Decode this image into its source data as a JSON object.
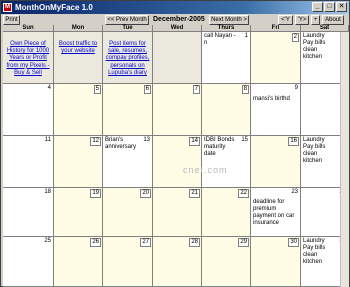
{
  "window": {
    "title": "MonthOnMyFace 1.0",
    "app_icon_letter": "M",
    "icons": {
      "app": "calendar-app-icon",
      "minimize": "minimize-icon",
      "maximize": "maximize-icon",
      "close": "close-icon"
    },
    "buttons": {
      "minimize": "_",
      "maximize": "□",
      "close": "✕"
    }
  },
  "toolbar": {
    "print_label": "Print",
    "prev_month_label": "<< Prev Month",
    "month_title": "December-2005",
    "next_month_label": "Next Month >",
    "prev_year_label": "<'Y",
    "next_year_label": "'Y>",
    "plus_label": "+",
    "about_label": "About"
  },
  "days_of_week": [
    "Sun",
    "Mon",
    "Tue",
    "Wed",
    "Thurs",
    "Fri",
    "Sat"
  ],
  "ads": {
    "sun": "Own Piece of History for 1000 Years or Profit from my Pixels - Buy & Sell",
    "mon": "Boost traffic to your website",
    "tue": "Post items for sale, resumes, compay profiles, personals on Lupuba's diary"
  },
  "week1": {
    "thu_note": "call Nayan - n",
    "thu_num": "1",
    "fri_num": "2",
    "sat_num": "3",
    "sat_notes": [
      "Laundry",
      "Pay bills",
      "clean kitchen"
    ]
  },
  "week2": {
    "nums": [
      "4",
      "5",
      "6",
      "7",
      "8",
      "9",
      "10"
    ],
    "fri_note": "mansi's birthd"
  },
  "week3": {
    "nums": [
      "11",
      "12",
      "13",
      "14",
      "15",
      "16",
      "17"
    ],
    "tue_notes": [
      "Brian's",
      "anniversary"
    ],
    "thu_notes": [
      "IDBI Bonds",
      "maturity",
      "date"
    ],
    "sat_notes": [
      "Laundry",
      "Pay bills",
      "clean kitchen"
    ]
  },
  "week4": {
    "nums": [
      "18",
      "19",
      "20",
      "21",
      "22",
      "23",
      "24"
    ],
    "fri_notes": [
      "deadline for",
      "premium",
      "payment on car",
      "insurance"
    ]
  },
  "week5": {
    "nums": [
      "25",
      "26",
      "27",
      "28",
      "29",
      "30",
      "31"
    ],
    "sat_notes": [
      "Laundry",
      "Pay bills",
      "clean kitchen"
    ]
  },
  "watermark": "cnet.com",
  "colors": {
    "titlebar_start": "#0a246a",
    "titlebar_end": "#a6caf0",
    "cell_shade": "#fffde6",
    "link": "#0000cc",
    "chrome": "#d4d0c8"
  }
}
